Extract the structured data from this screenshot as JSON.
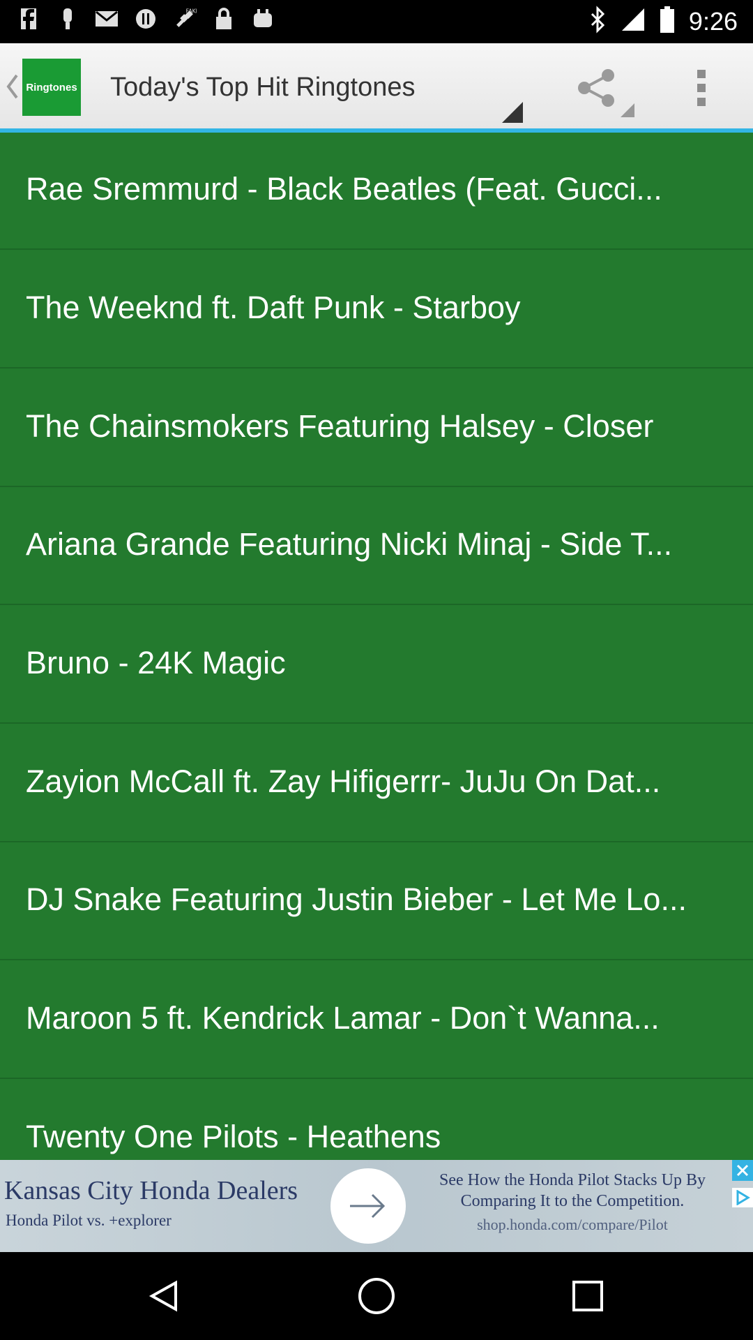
{
  "status_bar": {
    "time": "9:26",
    "left_icons": [
      "facebook-icon",
      "notification-icon",
      "gmail-icon",
      "sync-icon",
      "fake-gps-icon",
      "lock-icon",
      "android-icon"
    ],
    "right_icons": [
      "bluetooth-icon",
      "signal-icon",
      "battery-icon"
    ]
  },
  "action_bar": {
    "app_icon_label": "Ringtones",
    "title": "Today's Top Hit Ringtones",
    "accent_color": "#33b5e5"
  },
  "list": {
    "background_color": "#237a2e",
    "items": [
      {
        "label": "Rae Sremmurd - Black Beatles (Feat. Gucci..."
      },
      {
        "label": "The Weeknd ft. Daft Punk - Starboy"
      },
      {
        "label": "The Chainsmokers Featuring Halsey - Closer"
      },
      {
        "label": "Ariana Grande Featuring Nicki Minaj - Side T..."
      },
      {
        "label": "Bruno - 24K Magic"
      },
      {
        "label": "Zayion McCall ft. Zay Hifigerrr- JuJu On Dat..."
      },
      {
        "label": "DJ Snake Featuring Justin Bieber - Let Me Lo..."
      },
      {
        "label": "Maroon 5 ft. Kendrick Lamar - Don`t Wanna..."
      },
      {
        "label": "Twenty One Pilots - Heathens"
      }
    ]
  },
  "ad": {
    "headline": "Kansas City Honda Dealers",
    "subline": "Honda Pilot vs. +explorer",
    "right_text": "See How the Honda Pilot Stacks Up By Comparing It to the Competition.",
    "url": "shop.honda.com/compare/Pilot"
  },
  "nav_bar": {
    "buttons": [
      "back-icon",
      "home-icon",
      "recents-icon"
    ]
  }
}
